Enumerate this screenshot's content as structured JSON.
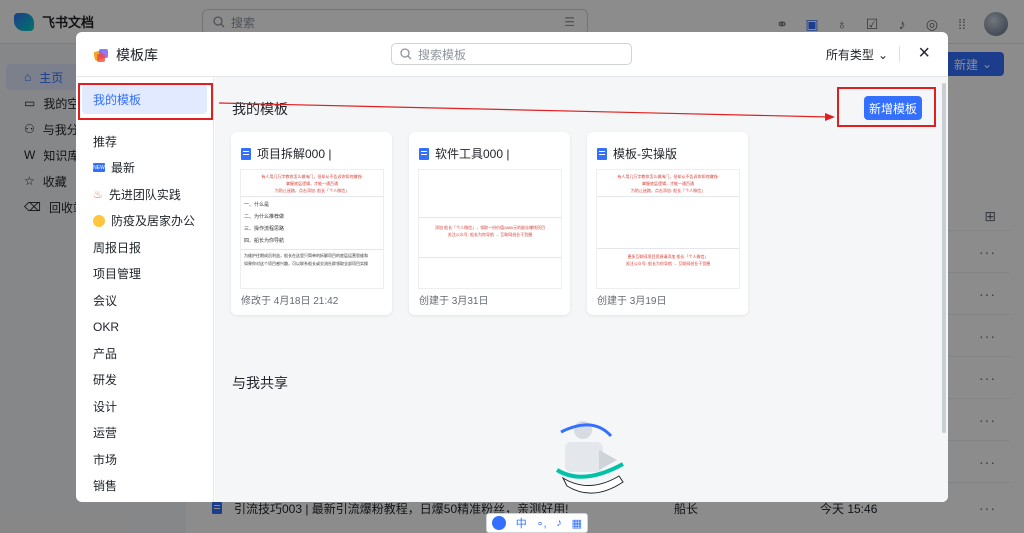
{
  "app": {
    "name": "飞书文档",
    "search_placeholder": "搜索",
    "new_button": "新建"
  },
  "sidebar": {
    "items": [
      {
        "label": "主页"
      },
      {
        "label": "我的空"
      },
      {
        "label": "与我分"
      },
      {
        "label": "知识库"
      },
      {
        "label": "收藏"
      },
      {
        "label": "回收站"
      }
    ]
  },
  "background_row": {
    "title": "引流技巧003 | 最新引流爆粉教程，日爆50精准粉丝，亲测好用!",
    "owner": "船长",
    "time": "今天 15:46"
  },
  "modal": {
    "title": "模板库",
    "search_placeholder": "搜索模板",
    "type_filter": "所有类型",
    "close": "×",
    "nav": [
      {
        "label": "我的模板"
      },
      {
        "label": "推荐"
      },
      {
        "label": "最新",
        "badge": "NEW"
      },
      {
        "label": "先进团队实践"
      },
      {
        "label": "防疫及居家办公"
      },
      {
        "label": "周报日报"
      },
      {
        "label": "项目管理"
      },
      {
        "label": "会议"
      },
      {
        "label": "OKR"
      },
      {
        "label": "产品"
      },
      {
        "label": "研发"
      },
      {
        "label": "设计"
      },
      {
        "label": "运营"
      },
      {
        "label": "市场"
      },
      {
        "label": "销售"
      }
    ],
    "section_mine": "我的模板",
    "section_shared": "与我共享",
    "add_button": "新增模板",
    "cards": [
      {
        "title": "项目拆解000 |",
        "footer": "修改于 4月18日 21:42",
        "preview_red": [
          "有人用几万字教你怎么做淘门，但却从不告诉你如何赚钱!",
          "掌握底层逻辑，才能一通百通",
          "为防止迷路，点击添加: 船长「个人微信」"
        ],
        "preview_lines": [
          "一、什么是",
          "二、为什么推荐做",
          "三、操作流程思路",
          "四、船长为你导航"
        ],
        "preview_small": [
          "为维护往期成员利益，船长在这里只简单的拆解项目的底层运营思维和",
          "如果你对这个项目感兴趣，可以联系船长或交流社群领取全部项目实操"
        ]
      },
      {
        "title": "软件工具000 |",
        "footer": "创建于 3月31日",
        "preview_red": [
          "添加 船长「个人微信」，领取一份价值2880元的副业赚钱项目",
          "关注公众号: 船长为你导航 → 互联网创业干货圈"
        ]
      },
      {
        "title": "模板-实操版",
        "footer": "创建于 3月19日",
        "preview_red": [
          "有人用几万字教你怎么做淘门，但却从不告诉你如何赚钱!",
          "掌握底层逻辑，才能一通百通",
          "为防止迷路，点击添加: 船长「个人微信」",
          "更多互联网项目资源请添加 船长「个人微信」",
          "关注公众号: 船长为你导航 → 互联网创业干货圈"
        ]
      }
    ]
  },
  "ime_bar": {
    "lang": "中"
  },
  "colors": {
    "accent": "#3370ff",
    "highlight": "#e02020"
  }
}
